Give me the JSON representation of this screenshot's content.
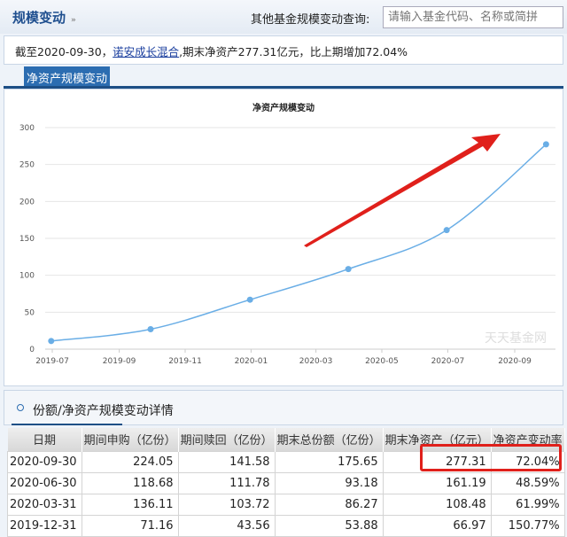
{
  "header": {
    "title": "规模变动",
    "title_mark": "»",
    "query_label": "其他基金规模变动查询:",
    "query_placeholder": "请输入基金代码、名称或简拼"
  },
  "summary": {
    "prefix": "截至2020-09-30，",
    "fund_name": "诺安成长混合",
    "suffix": ",期末净资产277.31亿元，比上期增加72.04%"
  },
  "tab": {
    "label": "净资产规模变动"
  },
  "chart_data": {
    "type": "line",
    "title": "净资产规模变动",
    "watermark": "天天基金网",
    "xlabel": "",
    "ylabel": "",
    "ylim": [
      0,
      300
    ],
    "yticks": [
      "0",
      "50",
      "100",
      "150",
      "200",
      "250",
      "300"
    ],
    "xticks": [
      "2019-07",
      "2019-09",
      "2019-11",
      "2020-01",
      "2020-03",
      "2020-05",
      "2020-07",
      "2020-09"
    ],
    "x": [
      "2019-06-30",
      "2019-09-30",
      "2019-12-31",
      "2020-03-31",
      "2020-06-30",
      "2020-09-30"
    ],
    "values": [
      11,
      27,
      66.97,
      108.48,
      161.19,
      277.31
    ],
    "color": "#6aaee6",
    "grid": true
  },
  "annotation": {
    "arrow_color": "#e0201b"
  },
  "section": {
    "title": "份额/净资产规模变动详情"
  },
  "table": {
    "headers": [
      "日期",
      "期间申购（亿份）",
      "期间赎回（亿份）",
      "期末总份额（亿份）",
      "期末净资产（亿元）",
      "净资产变动率"
    ],
    "rows": [
      [
        "2020-09-30",
        "224.05",
        "141.58",
        "175.65",
        "277.31",
        "72.04%"
      ],
      [
        "2020-06-30",
        "118.68",
        "111.78",
        "93.18",
        "161.19",
        "48.59%"
      ],
      [
        "2020-03-31",
        "136.11",
        "103.72",
        "86.27",
        "108.48",
        "61.99%"
      ],
      [
        "2019-12-31",
        "71.16",
        "43.56",
        "53.88",
        "66.97",
        "150.77%"
      ]
    ]
  }
}
